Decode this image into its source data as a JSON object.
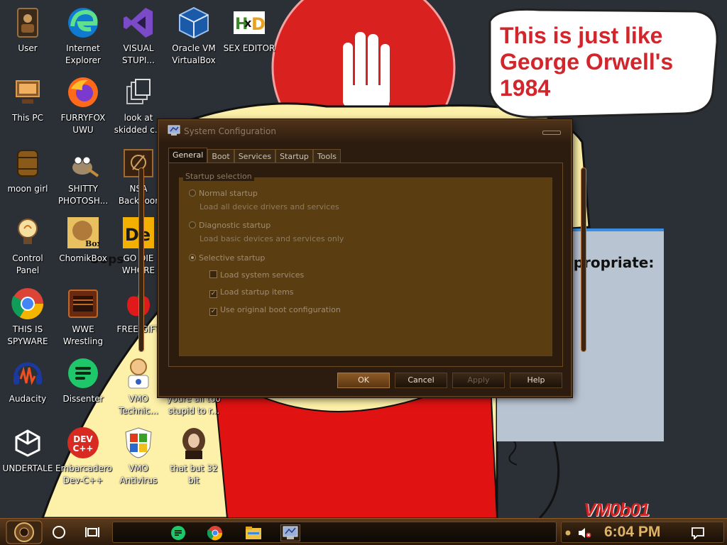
{
  "wallpaper": {
    "speech_bubble": [
      "This is just like",
      "George Orwell's",
      "1984"
    ],
    "background_dialog_text": "opropriate:",
    "background_oops_text": "Oops",
    "signature": "VM0b01",
    "colors": {
      "background": "#2b3036",
      "red": "#d9211f",
      "yellow": "#fdf0a8"
    }
  },
  "desktop_icons": [
    {
      "label": "User",
      "icon": "user-folder-icon"
    },
    {
      "label": "This PC",
      "icon": "computer-icon"
    },
    {
      "label": "moon girl",
      "icon": "barrel-icon"
    },
    {
      "label": "Control Panel",
      "icon": "lightbulb-icon"
    },
    {
      "label": "THIS IS SPYWARE",
      "icon": "chrome-icon"
    },
    {
      "label": "Audacity",
      "icon": "audacity-icon"
    },
    {
      "label": "UNDERTALE",
      "icon": "unity-icon"
    },
    {
      "label": "Internet Explorer",
      "icon": "edge-icon"
    },
    {
      "label": "FURRYFOX UWU",
      "icon": "firefox-icon"
    },
    {
      "label": "SHITTY PHOTOSH...",
      "icon": "gimp-icon"
    },
    {
      "label": "ChomikBox",
      "icon": "chomikbox-icon"
    },
    {
      "label": "WWE Wrestling",
      "icon": "wrestling-icon"
    },
    {
      "label": "Dissenter",
      "icon": "dissenter-icon"
    },
    {
      "label": "Embarcadero Dev-C++",
      "icon": "devcpp-icon"
    },
    {
      "label": "VISUAL STUPI...",
      "icon": "visual-studio-icon"
    },
    {
      "label": "look at skidded c...",
      "icon": "copy-icon"
    },
    {
      "label": "NSA Backdoor",
      "icon": "backdoor-icon"
    },
    {
      "label": "GO DIE WHORE",
      "icon": "dev-icon"
    },
    {
      "label": "FREE GIFT",
      "icon": "apple-icon"
    },
    {
      "label": "VMO Technic...",
      "icon": "technician-icon"
    },
    {
      "label": "VMO Antivirus",
      "icon": "shield-icon"
    },
    {
      "label": "Oracle VM VirtualBox",
      "icon": "virtualbox-icon"
    },
    {
      "label": "youre all too stupid to r...",
      "icon": "text-file-icon"
    },
    {
      "label": "that but 32 bit",
      "icon": "portrait-icon"
    },
    {
      "label": "SEX EDITOR",
      "icon": "hxd-icon"
    }
  ],
  "window": {
    "title": "System Configuration",
    "tabs": [
      "General",
      "Boot",
      "Services",
      "Startup",
      "Tools"
    ],
    "active_tab": "General",
    "group_title": "Startup selection",
    "options": {
      "normal": {
        "label": "Normal startup",
        "desc": "Load all device drivers and services"
      },
      "diagnostic": {
        "label": "Diagnostic startup",
        "desc": "Load basic devices and services only"
      },
      "selective": {
        "label": "Selective startup"
      }
    },
    "selected_option": "selective",
    "checkboxes": [
      {
        "label": "Load system services",
        "checked": false
      },
      {
        "label": "Load startup items",
        "checked": true
      },
      {
        "label": "Use original boot configuration",
        "checked": true
      }
    ],
    "buttons": {
      "ok": "OK",
      "cancel": "Cancel",
      "apply": "Apply",
      "help": "Help"
    }
  },
  "taskbar": {
    "pinned": [
      "dissenter-icon",
      "chrome-icon",
      "file-explorer-icon",
      "system-config-icon"
    ],
    "clock": "6:04 PM",
    "tray": [
      "speaker-muted-icon",
      "notification-icon"
    ],
    "accent": "#e0b468"
  }
}
